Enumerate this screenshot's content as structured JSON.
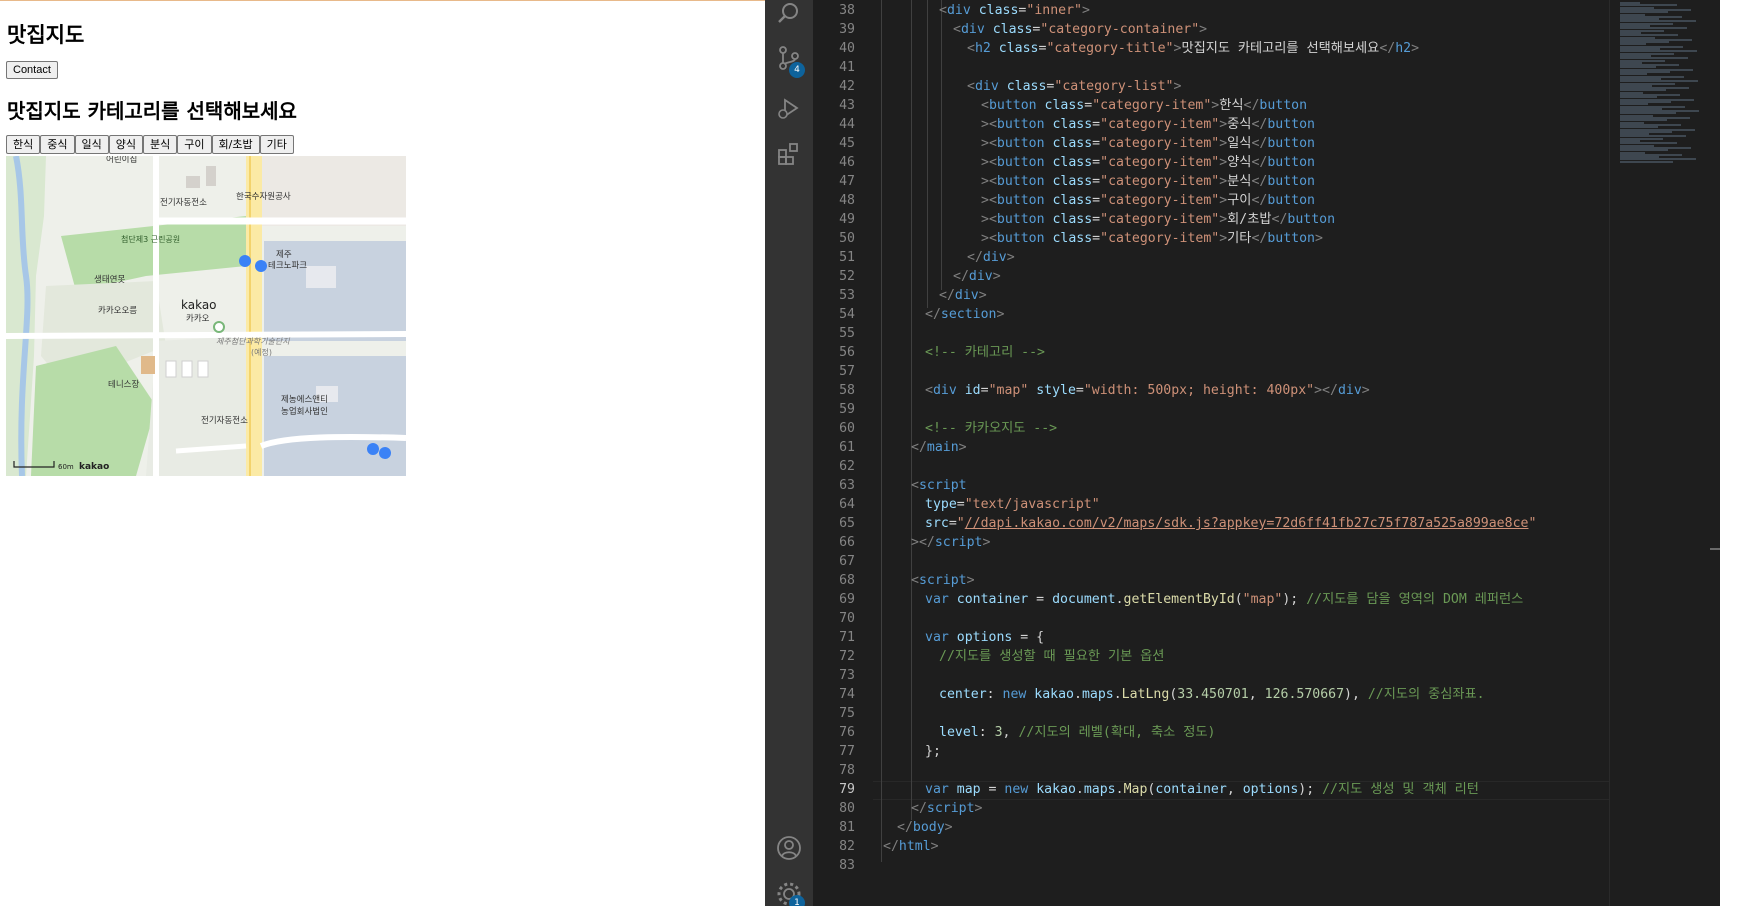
{
  "preview": {
    "site_title": "맛집지도",
    "contact_label": "Contact",
    "category_title": "맛집지도 카테고리를 선택해보세요",
    "categories": [
      "한식",
      "중식",
      "일식",
      "양식",
      "분식",
      "구이",
      "회/초밥",
      "기타"
    ],
    "map": {
      "labels": {
        "daycare": "어린이집",
        "substation_top": "전기자동전소",
        "water_corp": "한국수자원공사",
        "park": "첨단제3\n근린공원",
        "jeju_technopark_1": "제주",
        "jeju_technopark_2": "테크노파크",
        "forest": "생태연못",
        "kakao_orum": "카카오오름",
        "kakao_logo": "kakao",
        "kakao_kr": "카카오",
        "complex_1": "제주첨단과학기술단지",
        "complex_2": "(예정)",
        "tennis": "테니스장",
        "substation_bottom": "전기자동전소",
        "farm_1": "제농에스앤티",
        "farm_2": "농업회사법인",
        "scale": "60m",
        "brand": "kakao"
      }
    }
  },
  "editor": {
    "source_control_badge": "4",
    "settings_badge": "1",
    "current_line": 79,
    "lines": [
      {
        "n": 38,
        "indent": 4,
        "parts": [
          [
            "t-punct",
            "<"
          ],
          [
            "t-tag",
            "div"
          ],
          [
            "",
            ""
          ],
          [
            "t-attr",
            " class"
          ],
          [
            "",
            "="
          ],
          [
            "t-str",
            "\"inner\""
          ],
          [
            "t-punct",
            ">"
          ]
        ]
      },
      {
        "n": 39,
        "indent": 5,
        "parts": [
          [
            "t-punct",
            "<"
          ],
          [
            "t-tag",
            "div"
          ],
          [
            "t-attr",
            " class"
          ],
          [
            "",
            "="
          ],
          [
            "t-str",
            "\"category-container\""
          ],
          [
            "t-punct",
            ">"
          ]
        ]
      },
      {
        "n": 40,
        "indent": 6,
        "parts": [
          [
            "t-punct",
            "<"
          ],
          [
            "t-tag",
            "h2"
          ],
          [
            "t-attr",
            " class"
          ],
          [
            "",
            "="
          ],
          [
            "t-str",
            "\"category-title\""
          ],
          [
            "t-punct",
            ">"
          ],
          [
            "",
            "맛집지도 카테고리를 선택해보세요"
          ],
          [
            "t-punct",
            "</"
          ],
          [
            "t-tag",
            "h2"
          ],
          [
            "t-punct",
            ">"
          ]
        ]
      },
      {
        "n": 41,
        "indent": 0,
        "parts": []
      },
      {
        "n": 42,
        "indent": 6,
        "parts": [
          [
            "t-punct",
            "<"
          ],
          [
            "t-tag",
            "div"
          ],
          [
            "t-attr",
            " class"
          ],
          [
            "",
            "="
          ],
          [
            "t-str",
            "\"category-list\""
          ],
          [
            "t-punct",
            ">"
          ]
        ]
      },
      {
        "n": 43,
        "indent": 7,
        "parts": [
          [
            "t-punct",
            "<"
          ],
          [
            "t-tag",
            "button"
          ],
          [
            "t-attr",
            " class"
          ],
          [
            "",
            "="
          ],
          [
            "t-str",
            "\"category-item\""
          ],
          [
            "t-punct",
            ">"
          ],
          [
            "",
            "한식"
          ],
          [
            "t-punct",
            "</"
          ],
          [
            "t-tag",
            "button"
          ]
        ]
      },
      {
        "n": 44,
        "indent": 7,
        "parts": [
          [
            "t-punct",
            "><"
          ],
          [
            "t-tag",
            "button"
          ],
          [
            "t-attr",
            " class"
          ],
          [
            "",
            "="
          ],
          [
            "t-str",
            "\"category-item\""
          ],
          [
            "t-punct",
            ">"
          ],
          [
            "",
            "중식"
          ],
          [
            "t-punct",
            "</"
          ],
          [
            "t-tag",
            "button"
          ]
        ]
      },
      {
        "n": 45,
        "indent": 7,
        "parts": [
          [
            "t-punct",
            "><"
          ],
          [
            "t-tag",
            "button"
          ],
          [
            "t-attr",
            " class"
          ],
          [
            "",
            "="
          ],
          [
            "t-str",
            "\"category-item\""
          ],
          [
            "t-punct",
            ">"
          ],
          [
            "",
            "일식"
          ],
          [
            "t-punct",
            "</"
          ],
          [
            "t-tag",
            "button"
          ]
        ]
      },
      {
        "n": 46,
        "indent": 7,
        "parts": [
          [
            "t-punct",
            "><"
          ],
          [
            "t-tag",
            "button"
          ],
          [
            "t-attr",
            " class"
          ],
          [
            "",
            "="
          ],
          [
            "t-str",
            "\"category-item\""
          ],
          [
            "t-punct",
            ">"
          ],
          [
            "",
            "양식"
          ],
          [
            "t-punct",
            "</"
          ],
          [
            "t-tag",
            "button"
          ]
        ]
      },
      {
        "n": 47,
        "indent": 7,
        "parts": [
          [
            "t-punct",
            "><"
          ],
          [
            "t-tag",
            "button"
          ],
          [
            "t-attr",
            " class"
          ],
          [
            "",
            "="
          ],
          [
            "t-str",
            "\"category-item\""
          ],
          [
            "t-punct",
            ">"
          ],
          [
            "",
            "분식"
          ],
          [
            "t-punct",
            "</"
          ],
          [
            "t-tag",
            "button"
          ]
        ]
      },
      {
        "n": 48,
        "indent": 7,
        "parts": [
          [
            "t-punct",
            "><"
          ],
          [
            "t-tag",
            "button"
          ],
          [
            "t-attr",
            " class"
          ],
          [
            "",
            "="
          ],
          [
            "t-str",
            "\"category-item\""
          ],
          [
            "t-punct",
            ">"
          ],
          [
            "",
            "구이"
          ],
          [
            "t-punct",
            "</"
          ],
          [
            "t-tag",
            "button"
          ]
        ]
      },
      {
        "n": 49,
        "indent": 7,
        "parts": [
          [
            "t-punct",
            "><"
          ],
          [
            "t-tag",
            "button"
          ],
          [
            "t-attr",
            " class"
          ],
          [
            "",
            "="
          ],
          [
            "t-str",
            "\"category-item\""
          ],
          [
            "t-punct",
            ">"
          ],
          [
            "",
            "회/초밥"
          ],
          [
            "t-punct",
            "</"
          ],
          [
            "t-tag",
            "button"
          ]
        ]
      },
      {
        "n": 50,
        "indent": 7,
        "parts": [
          [
            "t-punct",
            "><"
          ],
          [
            "t-tag",
            "button"
          ],
          [
            "t-attr",
            " class"
          ],
          [
            "",
            "="
          ],
          [
            "t-str",
            "\"category-item\""
          ],
          [
            "t-punct",
            ">"
          ],
          [
            "",
            "기타"
          ],
          [
            "t-punct",
            "</"
          ],
          [
            "t-tag",
            "button"
          ],
          [
            "t-punct",
            ">"
          ]
        ]
      },
      {
        "n": 51,
        "indent": 6,
        "parts": [
          [
            "t-punct",
            "</"
          ],
          [
            "t-tag",
            "div"
          ],
          [
            "t-punct",
            ">"
          ]
        ]
      },
      {
        "n": 52,
        "indent": 5,
        "parts": [
          [
            "t-punct",
            "</"
          ],
          [
            "t-tag",
            "div"
          ],
          [
            "t-punct",
            ">"
          ]
        ]
      },
      {
        "n": 53,
        "indent": 4,
        "parts": [
          [
            "t-punct",
            "</"
          ],
          [
            "t-tag",
            "div"
          ],
          [
            "t-punct",
            ">"
          ]
        ]
      },
      {
        "n": 54,
        "indent": 3,
        "parts": [
          [
            "t-punct",
            "</"
          ],
          [
            "t-tag",
            "section"
          ],
          [
            "t-punct",
            ">"
          ]
        ]
      },
      {
        "n": 55,
        "indent": 0,
        "parts": []
      },
      {
        "n": 56,
        "indent": 3,
        "parts": [
          [
            "t-com",
            "<!-- 카테고리 -->"
          ]
        ]
      },
      {
        "n": 57,
        "indent": 0,
        "parts": []
      },
      {
        "n": 58,
        "indent": 3,
        "parts": [
          [
            "t-punct",
            "<"
          ],
          [
            "t-tag",
            "div"
          ],
          [
            "t-attr",
            " id"
          ],
          [
            "",
            "="
          ],
          [
            "t-str",
            "\"map\""
          ],
          [
            "t-attr",
            " style"
          ],
          [
            "",
            "="
          ],
          [
            "t-str",
            "\"width: 500px; height: 400px\""
          ],
          [
            "t-punct",
            "></"
          ],
          [
            "t-tag",
            "div"
          ],
          [
            "t-punct",
            ">"
          ]
        ]
      },
      {
        "n": 59,
        "indent": 0,
        "parts": []
      },
      {
        "n": 60,
        "indent": 3,
        "parts": [
          [
            "t-com",
            "<!-- 카카오지도 -->"
          ]
        ]
      },
      {
        "n": 61,
        "indent": 2,
        "parts": [
          [
            "t-punct",
            "</"
          ],
          [
            "t-tag",
            "main"
          ],
          [
            "t-punct",
            ">"
          ]
        ]
      },
      {
        "n": 62,
        "indent": 0,
        "parts": []
      },
      {
        "n": 63,
        "indent": 2,
        "parts": [
          [
            "t-punct",
            "<"
          ],
          [
            "t-tag",
            "script"
          ]
        ]
      },
      {
        "n": 64,
        "indent": 3,
        "parts": [
          [
            "t-attr",
            "type"
          ],
          [
            "",
            "="
          ],
          [
            "t-str",
            "\"text/javascript\""
          ]
        ]
      },
      {
        "n": 65,
        "indent": 3,
        "parts": [
          [
            "t-attr",
            "src"
          ],
          [
            "",
            "="
          ],
          [
            "t-str",
            "\""
          ],
          [
            "t-link",
            "//dapi.kakao.com/v2/maps/sdk.js?appkey=72d6ff41fb27c75f787a525a899ae8ce"
          ],
          [
            "t-str",
            "\""
          ]
        ]
      },
      {
        "n": 66,
        "indent": 2,
        "parts": [
          [
            "t-punct",
            "></"
          ],
          [
            "t-tag",
            "script"
          ],
          [
            "t-punct",
            ">"
          ]
        ]
      },
      {
        "n": 67,
        "indent": 0,
        "parts": []
      },
      {
        "n": 68,
        "indent": 2,
        "parts": [
          [
            "t-punct",
            "<"
          ],
          [
            "t-tag",
            "script"
          ],
          [
            "t-punct",
            ">"
          ]
        ]
      },
      {
        "n": 69,
        "indent": 3,
        "parts": [
          [
            "t-kw",
            "var"
          ],
          [
            "t-var",
            " container"
          ],
          [
            "",
            " = "
          ],
          [
            "t-var",
            "document"
          ],
          [
            "",
            "."
          ],
          [
            "t-fn",
            "getElementById"
          ],
          [
            "",
            "("
          ],
          [
            "t-str",
            "\"map\""
          ],
          [
            "",
            ");"
          ],
          [
            "t-com",
            " //지도를 담을 영역의 DOM 레퍼런스"
          ]
        ]
      },
      {
        "n": 70,
        "indent": 0,
        "parts": []
      },
      {
        "n": 71,
        "indent": 3,
        "parts": [
          [
            "t-kw",
            "var"
          ],
          [
            "t-var",
            " options"
          ],
          [
            "",
            " = {"
          ]
        ]
      },
      {
        "n": 72,
        "indent": 4,
        "parts": [
          [
            "t-com",
            "//지도를 생성할 때 필요한 기본 옵션"
          ]
        ]
      },
      {
        "n": 73,
        "indent": 0,
        "parts": []
      },
      {
        "n": 74,
        "indent": 4,
        "parts": [
          [
            "t-var",
            "center"
          ],
          [
            "",
            ": "
          ],
          [
            "t-kw",
            "new"
          ],
          [
            "t-var",
            " kakao"
          ],
          [
            "",
            "."
          ],
          [
            "t-var",
            "maps"
          ],
          [
            "",
            "."
          ],
          [
            "t-fn",
            "LatLng"
          ],
          [
            "",
            "("
          ],
          [
            "t-num",
            "33.450701"
          ],
          [
            "",
            ", "
          ],
          [
            "t-num",
            "126.570667"
          ],
          [
            "",
            "), "
          ],
          [
            "t-com",
            "//지도의 중심좌표."
          ]
        ]
      },
      {
        "n": 75,
        "indent": 0,
        "parts": []
      },
      {
        "n": 76,
        "indent": 4,
        "parts": [
          [
            "t-var",
            "level"
          ],
          [
            "",
            ": "
          ],
          [
            "t-num",
            "3"
          ],
          [
            "",
            ", "
          ],
          [
            "t-com",
            "//지도의 레벨(확대, 축소 정도)"
          ]
        ]
      },
      {
        "n": 77,
        "indent": 3,
        "parts": [
          [
            "",
            "};"
          ]
        ]
      },
      {
        "n": 78,
        "indent": 0,
        "parts": []
      },
      {
        "n": 79,
        "indent": 3,
        "parts": [
          [
            "t-kw",
            "var"
          ],
          [
            "t-var",
            " map"
          ],
          [
            "",
            " = "
          ],
          [
            "t-kw",
            "new"
          ],
          [
            "t-var",
            " kakao"
          ],
          [
            "",
            "."
          ],
          [
            "t-var",
            "maps"
          ],
          [
            "",
            "."
          ],
          [
            "t-fn",
            "Map"
          ],
          [
            "",
            "("
          ],
          [
            "t-var",
            "container"
          ],
          [
            "",
            ", "
          ],
          [
            "t-var",
            "options"
          ],
          [
            "",
            ");"
          ],
          [
            "t-com",
            " //지도 생성 및 객체 리턴"
          ]
        ]
      },
      {
        "n": 80,
        "indent": 2,
        "parts": [
          [
            "t-punct",
            "</"
          ],
          [
            "t-tag",
            "script"
          ],
          [
            "t-punct",
            ">"
          ]
        ]
      },
      {
        "n": 81,
        "indent": 1,
        "parts": [
          [
            "t-punct",
            "</"
          ],
          [
            "t-tag",
            "body"
          ],
          [
            "t-punct",
            ">"
          ]
        ]
      },
      {
        "n": 82,
        "indent": 0,
        "parts": [
          [
            "t-punct",
            "</"
          ],
          [
            "t-tag",
            "html"
          ],
          [
            "t-punct",
            ">"
          ]
        ]
      },
      {
        "n": 83,
        "indent": 0,
        "parts": []
      }
    ]
  }
}
